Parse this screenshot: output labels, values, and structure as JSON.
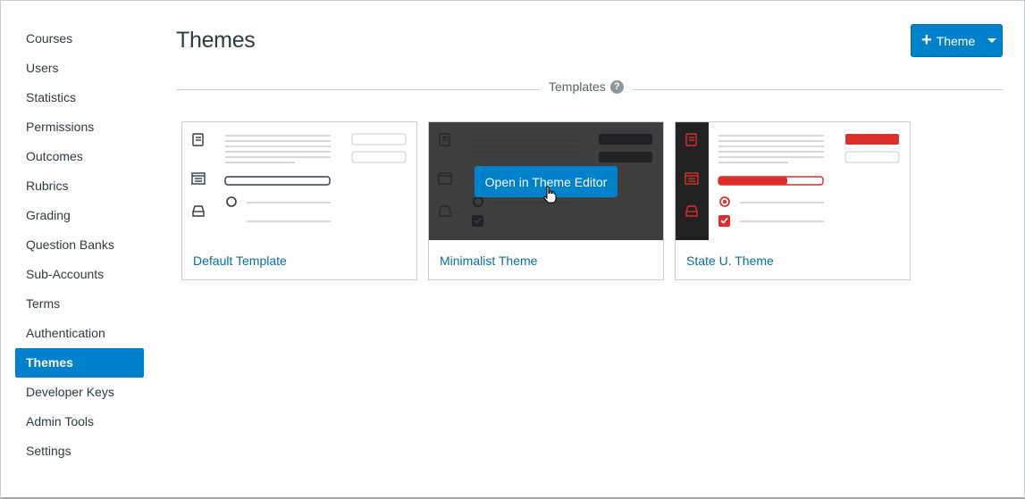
{
  "sidebar": {
    "items": [
      {
        "label": "Courses",
        "active": false
      },
      {
        "label": "Users",
        "active": false
      },
      {
        "label": "Statistics",
        "active": false
      },
      {
        "label": "Permissions",
        "active": false
      },
      {
        "label": "Outcomes",
        "active": false
      },
      {
        "label": "Rubrics",
        "active": false
      },
      {
        "label": "Grading",
        "active": false
      },
      {
        "label": "Question Banks",
        "active": false
      },
      {
        "label": "Sub-Accounts",
        "active": false
      },
      {
        "label": "Terms",
        "active": false
      },
      {
        "label": "Authentication",
        "active": false
      },
      {
        "label": "Themes",
        "active": true
      },
      {
        "label": "Developer Keys",
        "active": false
      },
      {
        "label": "Admin Tools",
        "active": false
      },
      {
        "label": "Settings",
        "active": false
      }
    ]
  },
  "header": {
    "title": "Themes",
    "add_button": {
      "icon": "plus-icon",
      "label": "Theme",
      "dropdown_icon": "caret-down-icon"
    }
  },
  "section": {
    "label": "Templates",
    "help_icon": "?"
  },
  "cards": [
    {
      "name": "Default Template",
      "style": "default"
    },
    {
      "name": "Minimalist Theme",
      "style": "minimalist",
      "hover_button": "Open in Theme Editor"
    },
    {
      "name": "State U. Theme",
      "style": "stateu"
    }
  ],
  "colors": {
    "accent": "#0081cc",
    "link": "#0770a3",
    "stateu_red": "#d9302c",
    "minimalist_dark": "#222222",
    "minimalist_navy": "#0c1b3a"
  }
}
